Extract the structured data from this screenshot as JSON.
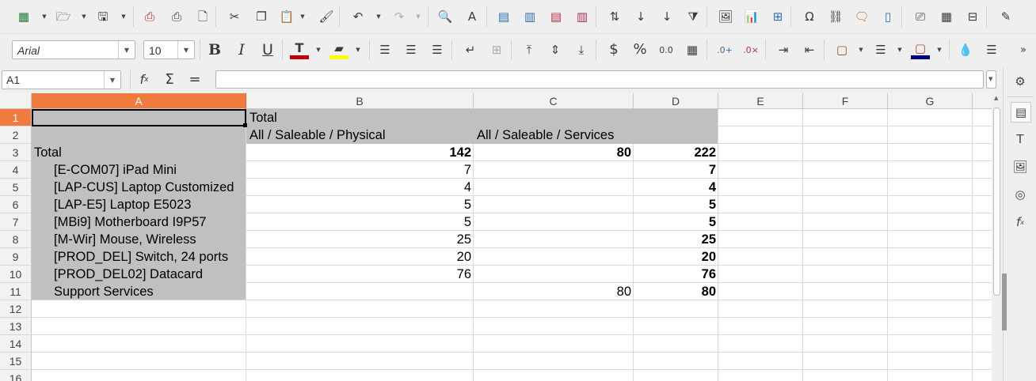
{
  "toolbar1": {
    "icons": [
      "insert-table-icon",
      "open-icon",
      "save-icon",
      "export-pdf-icon",
      "print-icon",
      "print-preview-icon",
      "cut-icon",
      "copy-icon",
      "paste-icon",
      "clone-formatting-icon",
      "undo-icon",
      "redo-icon",
      "find-replace-icon",
      "spelling-icon",
      "row-icon",
      "column-icon",
      "delete-row-icon",
      "delete-column-icon",
      "sort-icon",
      "sort-ascending-icon",
      "sort-descending-icon",
      "autofilter-icon",
      "insert-image-icon",
      "insert-chart-icon",
      "pivot-table-icon",
      "special-character-icon",
      "hyperlink-icon",
      "comment-icon",
      "headers-footers-icon",
      "define-print-area-icon",
      "freeze-rows-columns-icon",
      "split-window-icon",
      "draw-functions-icon"
    ]
  },
  "toolbar2": {
    "font_name": "Arial",
    "font_size": "10",
    "bold": "B",
    "italic": "I",
    "underline": "U",
    "font_color": "#c00000",
    "highlight_color": "#ffff00",
    "border_color": "#a64b00",
    "background_color": "#000080",
    "currency": "$",
    "percent": "%",
    "number_format": "0.0"
  },
  "formula_bar": {
    "name_box": "A1",
    "function_wizard": "fx",
    "sum": "Σ",
    "equals": "=",
    "formula": ""
  },
  "sheet": {
    "columns": [
      "A",
      "B",
      "C",
      "D",
      "E",
      "F",
      "G"
    ],
    "selected_column": "A",
    "rows": [
      "1",
      "2",
      "3",
      "4",
      "5",
      "6",
      "7",
      "8",
      "9",
      "10",
      "11",
      "12",
      "13",
      "14",
      "15",
      "16"
    ],
    "selected_row": "1",
    "header": {
      "b1": "Total",
      "b2": "All / Saleable / Physical",
      "c2": "All / Saleable / Services"
    },
    "total_row": {
      "label": "Total",
      "physical": "142",
      "services": "80",
      "total": "222"
    },
    "items": [
      {
        "label": "[E-COM07] iPad Mini",
        "physical": "7",
        "services": "",
        "total": "7"
      },
      {
        "label": "[LAP-CUS] Laptop Customized",
        "physical": "4",
        "services": "",
        "total": "4"
      },
      {
        "label": "[LAP-E5] Laptop E5023",
        "physical": "5",
        "services": "",
        "total": "5"
      },
      {
        "label": "[MBi9] Motherboard I9P57",
        "physical": "5",
        "services": "",
        "total": "5"
      },
      {
        "label": "[M-Wir] Mouse, Wireless",
        "physical": "25",
        "services": "",
        "total": "25"
      },
      {
        "label": "[PROD_DEL] Switch, 24 ports",
        "physical": "20",
        "services": "",
        "total": "20"
      },
      {
        "label": "[PROD_DEL02] Datacard",
        "physical": "76",
        "services": "",
        "total": "76"
      },
      {
        "label": "Support Services",
        "physical": "",
        "services": "80",
        "total": "80"
      }
    ]
  },
  "sidebar": {
    "icons": [
      "properties-icon",
      "page-icon",
      "styles-icon",
      "gallery-icon",
      "navigator-icon",
      "functions-icon"
    ]
  }
}
